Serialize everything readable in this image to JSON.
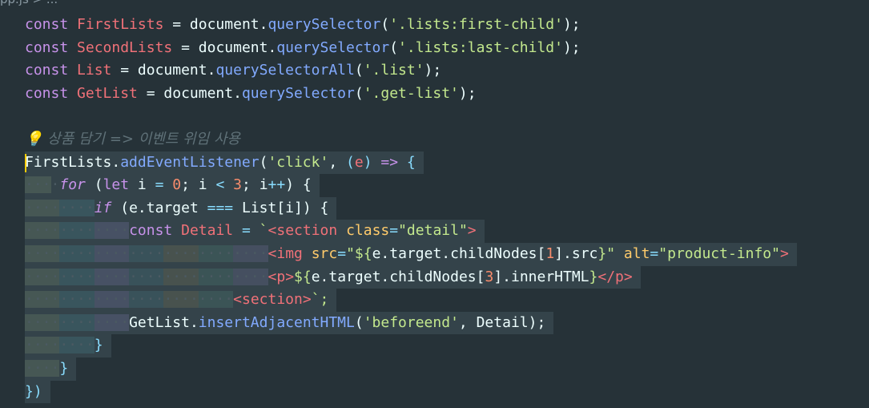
{
  "breadcrumb": "pp.js > ...",
  "comment": "💡 상품 담기 => 이벤트 위임 사용",
  "code": {
    "l1": [
      "const",
      " ",
      "FirstLists",
      " = ",
      "document",
      ".",
      "querySelector",
      "(",
      "'.lists:first-child'",
      ");"
    ],
    "l2": [
      "const",
      " ",
      "SecondLists",
      " = ",
      "document",
      ".",
      "querySelector",
      "(",
      "'.lists:last-child'",
      ");"
    ],
    "l3": [
      "const",
      " ",
      "List",
      " = ",
      "document",
      ".",
      "querySelectorAll",
      "(",
      "'.list'",
      ");"
    ],
    "l4": [
      "const",
      " ",
      "GetList",
      " = ",
      "document",
      ".",
      "querySelector",
      "(",
      "'.get-list'",
      ");"
    ],
    "l6": [
      "FirstLists",
      ".",
      "addEventListener",
      "(",
      "'click'",
      ", ",
      "(",
      "e",
      ")",
      " => ",
      "{"
    ],
    "l7": [
      "for",
      " (",
      "let",
      " i ",
      "=",
      " ",
      "0",
      "; i ",
      "<",
      " ",
      "3",
      "; i",
      "++",
      ") {"
    ],
    "l8": [
      "if",
      " (e.target ",
      "===",
      " List[i]) {"
    ],
    "l9": [
      "const",
      " ",
      "Detail",
      " ",
      "=",
      " `",
      "<section",
      " ",
      "class",
      "=",
      "\"detail\"",
      ">"
    ],
    "l10": [
      "<img",
      " ",
      "src",
      "=",
      "\"${",
      "e.target.childNodes[",
      "1",
      "].src",
      "}\"",
      " ",
      "alt",
      "=",
      "\"product-info\"",
      ">"
    ],
    "l11": [
      "<p>",
      "${",
      "e.target.childNodes[",
      "3",
      "].innerHTML",
      "}",
      "</p>"
    ],
    "l12": [
      "<section>",
      "`;"
    ],
    "l13": [
      "GetList",
      ".",
      "insertAdjacentHTML",
      "(",
      "'beforeend'",
      ", Detail);"
    ],
    "l14": [
      "}"
    ],
    "l15": [
      "}"
    ],
    "l16": [
      "})"
    ]
  }
}
